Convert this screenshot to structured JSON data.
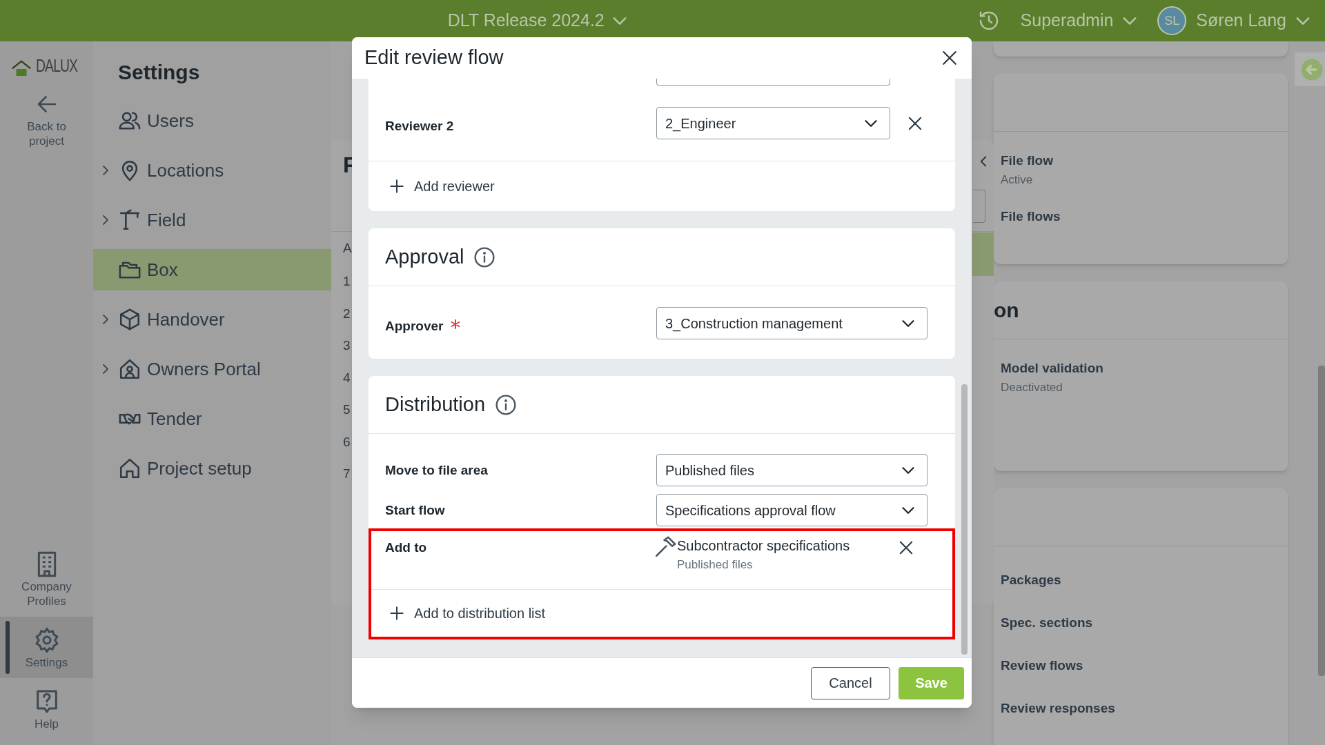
{
  "top_bar": {
    "project": "DLT Release 2024.2",
    "role": "Superadmin",
    "user_initials": "SL",
    "user_name": "Søren Lang"
  },
  "rail": {
    "logo": "DALUX",
    "back_label": "Back to project",
    "items": [
      {
        "kind": "company",
        "label": "Company Profiles",
        "selected": false
      },
      {
        "kind": "settings",
        "label": "Settings",
        "selected": true
      },
      {
        "kind": "help",
        "label": "Help",
        "selected": false
      }
    ]
  },
  "settings_nav": {
    "title": "Settings",
    "items": [
      {
        "label": "Users",
        "expandable": false,
        "selected": false
      },
      {
        "label": "Locations",
        "expandable": true,
        "selected": false
      },
      {
        "label": "Field",
        "expandable": true,
        "selected": false
      },
      {
        "label": "Box",
        "expandable": false,
        "selected": true
      },
      {
        "label": "Handover",
        "expandable": true,
        "selected": false
      },
      {
        "label": "Owners Portal",
        "expandable": true,
        "selected": false
      },
      {
        "label": "Tender",
        "expandable": false,
        "selected": false
      },
      {
        "label": "Project setup",
        "expandable": false,
        "selected": false
      }
    ]
  },
  "back_panel": {
    "title": "F",
    "column": "A",
    "row_numbers": [
      "1",
      "2",
      "3",
      "4",
      "5",
      "6",
      "7"
    ]
  },
  "right_cards": [
    {
      "kind": "stub"
    },
    {
      "kind": "card",
      "items": [
        {
          "title": "File flow",
          "status": "Active"
        },
        {
          "title": "File flows"
        }
      ]
    },
    {
      "kind": "card",
      "heading": "on",
      "items": [
        {
          "title": "Model validation",
          "status": "Deactivated"
        }
      ]
    },
    {
      "kind": "card",
      "items": [
        {
          "title": "Packages"
        },
        {
          "title": "Spec. sections"
        },
        {
          "title": "Review flows"
        },
        {
          "title": "Review responses"
        }
      ]
    }
  ],
  "modal": {
    "title": "Edit review flow",
    "reviewers": {
      "rows": [
        {
          "label": "Reviewer 2",
          "value": "2_Engineer"
        }
      ],
      "add_label": "Add reviewer"
    },
    "approval": {
      "heading": "Approval",
      "rows": [
        {
          "label": "Approver",
          "required": true,
          "value": "3_Construction management"
        }
      ]
    },
    "distribution": {
      "heading": "Distribution",
      "rows": [
        {
          "kind": "select",
          "label": "Move to file area",
          "value": "Published files"
        },
        {
          "kind": "select",
          "label": "Start flow",
          "value": "Specifications approval flow"
        },
        {
          "kind": "list",
          "label": "Add to",
          "entries": [
            {
              "name": "Subcontractor specifications",
              "area": "Published files"
            }
          ]
        }
      ],
      "add_label": "Add to distribution list"
    },
    "buttons": {
      "cancel": "Cancel",
      "save": "Save"
    }
  }
}
